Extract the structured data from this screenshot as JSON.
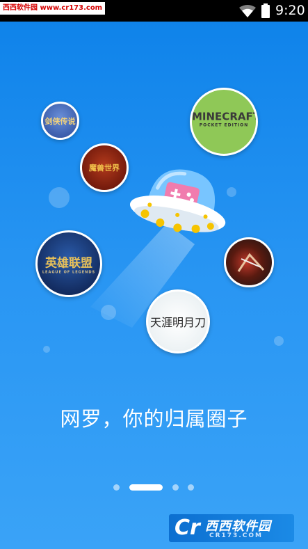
{
  "status_bar": {
    "watermark": "西西软件园 www.cr173.com",
    "time": "9:20",
    "icons": [
      "wifi-icon",
      "battery-icon"
    ]
  },
  "games": {
    "jianxia": "剑侠传说",
    "minecraft": "MINECRAFT",
    "minecraft_sub": "POCKET EDITION",
    "mohe": "魔兽世界",
    "lol": "英雄联盟",
    "lol_sub": "LEAGUE OF LEGENDS",
    "tianya": "天涯明月刀"
  },
  "onboarding": {
    "headline": "网罗，你的归属圈子",
    "page_count": 4,
    "active_page": 1
  },
  "footer_logo": {
    "mark": "Cr",
    "name": "西西软件园",
    "url": "CR173.COM"
  },
  "colors": {
    "background": "#1E8FF0",
    "ufo_dome": "#7DC8FF",
    "gamepad": "#F07CAE",
    "ufo_lights": "#F6C400"
  }
}
